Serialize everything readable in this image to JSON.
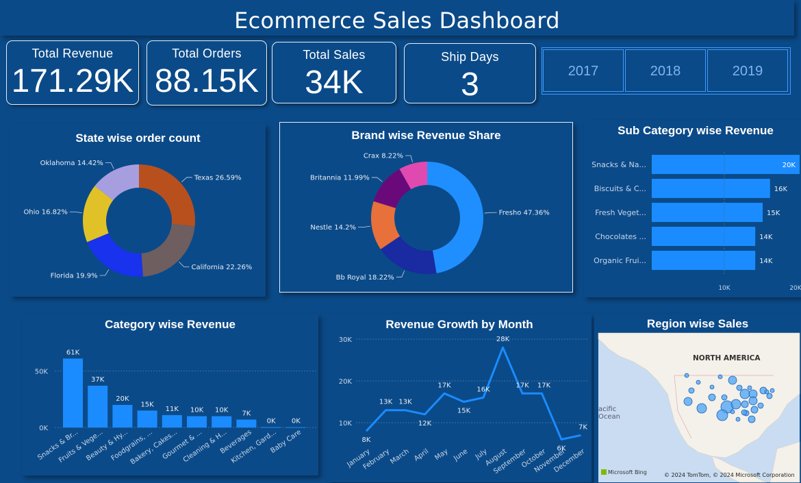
{
  "dashboard": {
    "title": "Ecommerce Sales Dashboard"
  },
  "kpis": [
    {
      "label": "Total Revenue",
      "value": "171.29K"
    },
    {
      "label": "Total Orders",
      "value": "88.15K"
    },
    {
      "label": "Total Sales",
      "value": "34K"
    },
    {
      "label": "Ship Days",
      "value": "3"
    }
  ],
  "years": [
    "2017",
    "2018",
    "2019"
  ],
  "colors": {
    "background": "#0b4a88",
    "bar": "#1a8cff",
    "line": "#1a8cff"
  },
  "chart_data": [
    {
      "type": "pie",
      "title": "State wise order count",
      "categories": [
        "Texas",
        "California",
        "Florida",
        "Ohio",
        "Oklahoma"
      ],
      "values": [
        26.59,
        22.26,
        19.9,
        16.82,
        14.42
      ],
      "labels": [
        "Texas 26.59%",
        "California 22.26%",
        "Florida 19.9%",
        "Ohio 16.82%",
        "Oklahoma 14.42%"
      ],
      "colors": [
        "#b8501e",
        "#6e5e60",
        "#1832ee",
        "#e0c228",
        "#a79ee0"
      ]
    },
    {
      "type": "pie",
      "title": "Brand wise Revenue Share",
      "categories": [
        "Fresho",
        "Bb Royal",
        "Nestle",
        "Britannia",
        "Crax"
      ],
      "values": [
        47.36,
        18.22,
        14.2,
        11.99,
        8.22
      ],
      "labels": [
        "Fresho 47.36%",
        "Bb Royal 18.22%",
        "Nestle 14.2%",
        "Britannia 11.99%",
        "Crax 8.22%"
      ],
      "colors": [
        "#1f8fff",
        "#1a2aa0",
        "#e8703a",
        "#6a0a7a",
        "#e04ab0"
      ]
    },
    {
      "type": "bar",
      "orientation": "horizontal",
      "title": "Sub Category wise Revenue",
      "categories": [
        "Snacks & Na...",
        "Biscuits & C...",
        "Fresh Veget...",
        "Chocolates ...",
        "Organic Frui..."
      ],
      "values": [
        20,
        16,
        15,
        14,
        14
      ],
      "data_labels": [
        "20K",
        "16K",
        "15K",
        "14K",
        "14K"
      ],
      "x_ticks": [
        "10K",
        "20K"
      ],
      "xlim": [
        0,
        20
      ]
    },
    {
      "type": "bar",
      "title": "Category wise Revenue",
      "categories": [
        "Snacks & Br...",
        "Fruits & Vege...",
        "Beauty & Hy...",
        "Foodgrains, ...",
        "Bakery, Cakes...",
        "Gourmet & ...",
        "Cleaning & H...",
        "Beverages",
        "Kitchen, Gard...",
        "Baby Care"
      ],
      "values": [
        61,
        37,
        20,
        15,
        11,
        10,
        10,
        7,
        0.4,
        0.3
      ],
      "data_labels": [
        "61K",
        "37K",
        "20K",
        "15K",
        "11K",
        "10K",
        "10K",
        "7K",
        "0K",
        "0K"
      ],
      "y_ticks": [
        "0K",
        "50K"
      ],
      "ylim": [
        0,
        60
      ]
    },
    {
      "type": "line",
      "title": "Revenue Growth by Month",
      "categories": [
        "January",
        "February",
        "March",
        "April",
        "May",
        "June",
        "July",
        "August",
        "September",
        "October",
        "November",
        "December"
      ],
      "values": [
        8,
        13,
        13,
        12,
        17,
        15,
        16,
        28,
        17,
        17,
        6,
        7
      ],
      "data_labels": [
        "8K",
        "13K",
        "13K",
        "12K",
        "17K",
        "15K",
        "16K",
        "28K",
        "17K",
        "17K",
        "6K",
        "7K"
      ],
      "y_ticks": [
        "10K",
        "20K",
        "30K"
      ],
      "ylim": [
        5,
        30
      ]
    }
  ],
  "map": {
    "title": "Region wise Sales",
    "region_label": "NORTH AMERICA",
    "ocean_label": "acific\nOcean",
    "attribution": "© 2024 TomTom, © 2024 Microsoft Corporation",
    "logo": "Microsoft Bing"
  }
}
